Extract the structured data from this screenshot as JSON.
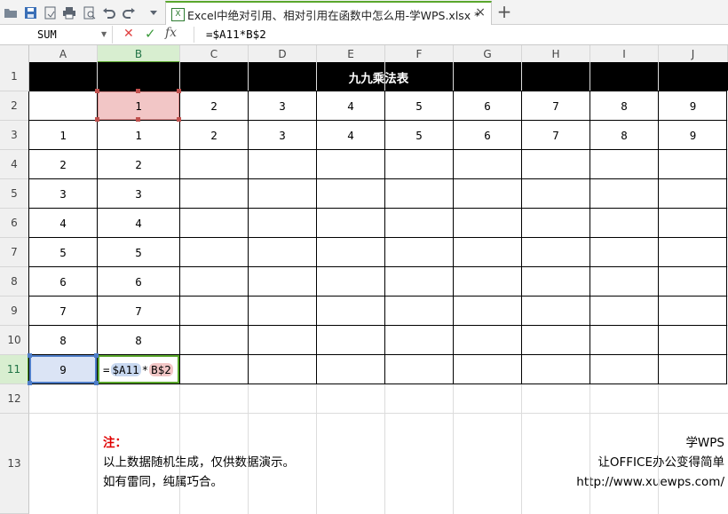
{
  "window": {
    "tab_title": "Excel中绝对引用、相对引用在函数中怎么用-学WPS.xlsx *",
    "tab_close": "×",
    "new_tab": "+"
  },
  "toolbar": {
    "icons": [
      "open-icon",
      "save-icon",
      "save-as-icon",
      "print-icon",
      "print-preview-icon",
      "undo-icon",
      "redo-icon",
      "more-dropdown-icon"
    ]
  },
  "formula_bar": {
    "name_box": "SUM",
    "cancel": "✕",
    "enter": "✓",
    "fx": "fx",
    "content": "=$A11*B$2"
  },
  "columns": [
    "A",
    "B",
    "C",
    "D",
    "E",
    "F",
    "G",
    "H",
    "I",
    "J"
  ],
  "rows": [
    "1",
    "2",
    "3",
    "4",
    "5",
    "6",
    "7",
    "8",
    "9",
    "10",
    "11",
    "12",
    "13"
  ],
  "selected_column": "B",
  "selected_row": "11",
  "sheet": {
    "title": "九九乘法表",
    "row2": [
      "",
      "1",
      "2",
      "3",
      "4",
      "5",
      "6",
      "7",
      "8",
      "9"
    ],
    "row3": [
      "1",
      "1",
      "2",
      "3",
      "4",
      "5",
      "6",
      "7",
      "8",
      "9"
    ],
    "col_a": [
      "2",
      "3",
      "4",
      "5",
      "6",
      "7",
      "8",
      "9"
    ],
    "col_b": [
      "2",
      "3",
      "4",
      "5",
      "6",
      "7",
      "8"
    ],
    "editing_cell": {
      "eq": "=",
      "ref1": "$A11",
      "op": "*",
      "ref2": "B$2"
    }
  },
  "note": {
    "label": "注：",
    "line1": "以上数据随机生成，仅供数据演示。",
    "line2": "如有雷同，纯属巧合。"
  },
  "brand": {
    "name": "学WPS",
    "slogan": "让OFFICE办公变得简单",
    "url": "http://www.xuewps.com/"
  },
  "colors": {
    "ref1_highlight": "#c8d8f0",
    "ref2_highlight": "#f2c6c6",
    "selection_green": "#5aa72c",
    "note_red": "#e00000"
  }
}
